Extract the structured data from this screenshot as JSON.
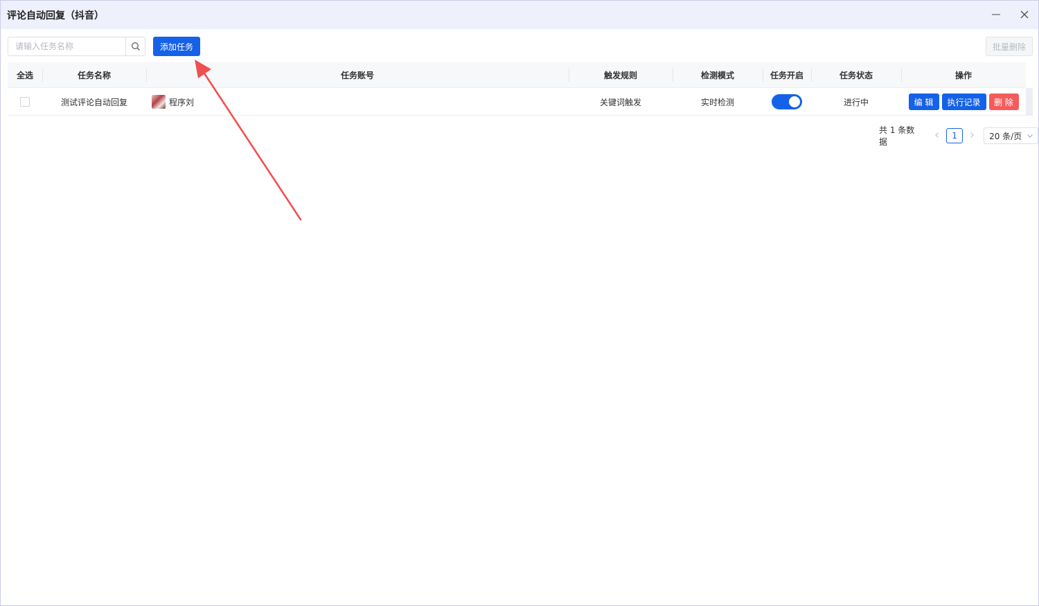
{
  "window": {
    "title": "评论自动回复（抖音）",
    "minimize_icon": "minimize-icon",
    "close_icon": "close-icon"
  },
  "toolbar": {
    "search_placeholder": "请输入任务名称",
    "search_value": "",
    "search_icon": "search-icon",
    "add_task_label": "添加任务",
    "batch_delete_label": "批量删除"
  },
  "table": {
    "headers": {
      "select_all": "全选",
      "task_name": "任务名称",
      "task_account": "任务账号",
      "trigger_rule": "触发规则",
      "detect_mode": "检测模式",
      "task_enabled": "任务开启",
      "task_status": "任务状态",
      "actions": "操作"
    },
    "rows": [
      {
        "selected": false,
        "task_name": "测试评论自动回复",
        "account_name": "程序刘",
        "trigger_rule": "关键词触发",
        "detect_mode": "实时检测",
        "enabled": true,
        "status": "进行中",
        "edit_label": "编 辑",
        "log_label": "执行记录",
        "delete_label": "删 除"
      }
    ]
  },
  "pagination": {
    "total_text": "共 1 条数据",
    "prev_icon": "chevron-left-icon",
    "next_icon": "chevron-right-icon",
    "current_page": "1",
    "page_size": "20 条/页",
    "page_size_icon": "chevron-down-icon"
  },
  "colors": {
    "primary": "#1561e8",
    "danger": "#f55b5b",
    "titlebar_bg": "#eef0fc",
    "annotation_arrow": "#f05050"
  }
}
